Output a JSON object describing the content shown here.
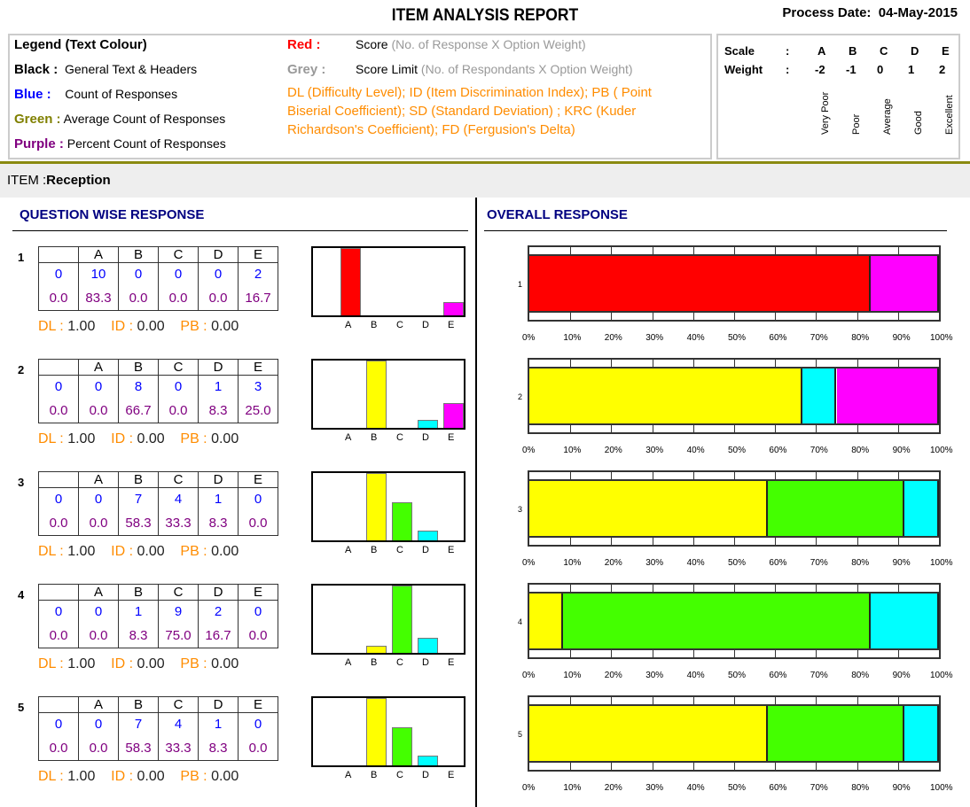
{
  "header": {
    "title": "ITEM ANALYSIS REPORT",
    "process_date_label": "Process Date:",
    "process_date": "04-May-2015"
  },
  "legend": {
    "title": "Legend (Text Colour)",
    "black_key": "Black :",
    "black_text": "General Text & Headers",
    "blue_key": "Blue :",
    "blue_text": "Count of Responses",
    "green_key": "Green :",
    "green_text": "Average Count of Responses",
    "purple_key": "Purple :",
    "purple_text": "Percent Count of Responses",
    "red_key": "Red :",
    "red_text": "Score",
    "red_note": "(No. of Response X Option Weight)",
    "grey_key": "Grey :",
    "grey_text": "Score Limit",
    "grey_note": "(No. of Respondants X Option Weight)",
    "abbrev": "DL (Difficulty Level); ID (Item Discrimination Index); PB ( Point Biserial Coefficient); SD (Standard Deviation) ; KRC (Kuder Richardson's Coefficient); FD (Fergusion's Delta)"
  },
  "scale": {
    "scale_label": "Scale",
    "weight_label": "Weight",
    "colon": ":",
    "options": [
      "A",
      "B",
      "C",
      "D",
      "E"
    ],
    "weights": [
      "-2",
      "-1",
      "0",
      "1",
      "2"
    ],
    "names": [
      "Very Poor",
      "Poor",
      "Average",
      "Good",
      "Excellent"
    ]
  },
  "item": {
    "label": "ITEM :",
    "name": "Reception"
  },
  "sections": {
    "left": "QUESTION WISE RESPONSE",
    "right": "OVERALL RESPONSE"
  },
  "colors": {
    "A": "#ff0000",
    "B": "#ffff00",
    "C": "#44ff00",
    "D": "#00ffff",
    "E": "#ff00ff"
  },
  "stat_labels": {
    "dl": "DL :",
    "id": "ID :",
    "pb": "PB :"
  },
  "questions": [
    {
      "no": "1",
      "counts": [
        "0",
        "10",
        "0",
        "0",
        "0",
        "2"
      ],
      "percents": [
        "0.0",
        "83.3",
        "0.0",
        "0.0",
        "0.0",
        "16.7"
      ],
      "dl": "1.00",
      "id": "0.00",
      "pb": "0.00"
    },
    {
      "no": "2",
      "counts": [
        "0",
        "0",
        "8",
        "0",
        "1",
        "3"
      ],
      "percents": [
        "0.0",
        "0.0",
        "66.7",
        "0.0",
        "8.3",
        "25.0"
      ],
      "dl": "1.00",
      "id": "0.00",
      "pb": "0.00"
    },
    {
      "no": "3",
      "counts": [
        "0",
        "0",
        "7",
        "4",
        "1",
        "0"
      ],
      "percents": [
        "0.0",
        "0.0",
        "58.3",
        "33.3",
        "8.3",
        "0.0"
      ],
      "dl": "1.00",
      "id": "0.00",
      "pb": "0.00"
    },
    {
      "no": "4",
      "counts": [
        "0",
        "0",
        "1",
        "9",
        "2",
        "0"
      ],
      "percents": [
        "0.0",
        "0.0",
        "8.3",
        "75.0",
        "16.7",
        "0.0"
      ],
      "dl": "1.00",
      "id": "0.00",
      "pb": "0.00"
    },
    {
      "no": "5",
      "counts": [
        "0",
        "0",
        "7",
        "4",
        "1",
        "0"
      ],
      "percents": [
        "0.0",
        "0.0",
        "58.3",
        "33.3",
        "8.3",
        "0.0"
      ],
      "dl": "1.00",
      "id": "0.00",
      "pb": "0.00"
    }
  ],
  "chart_data": {
    "type": "bar",
    "stacked_overall": true,
    "categories": [
      "A",
      "B",
      "C",
      "D",
      "E"
    ],
    "x_ticks": [
      "0%",
      "10%",
      "20%",
      "30%",
      "40%",
      "50%",
      "60%",
      "70%",
      "80%",
      "90%",
      "100%"
    ],
    "xlim": [
      0,
      100
    ]
  }
}
